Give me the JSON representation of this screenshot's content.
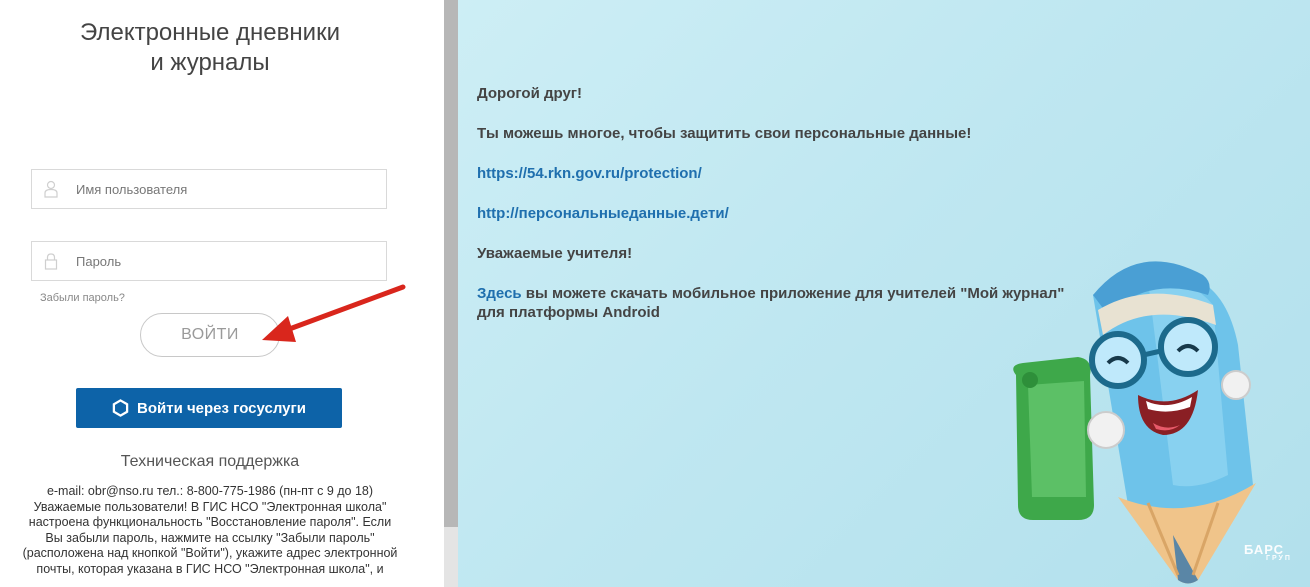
{
  "login": {
    "title": "Электронные дневники\nи журналы",
    "username_placeholder": "Имя пользователя",
    "password_placeholder": "Пароль",
    "forgot_link": "Забыли пароль?",
    "login_button": "ВОЙТИ",
    "gosuslugi_button": "Войти через госуслуги",
    "support_title": "Техническая поддержка",
    "support_text": "e-mail: obr@nso.ru тел.: 8-800-775-1986 (пн-пт с 9 до 18) Уважаемые пользователи! В ГИС НСО \"Электронная школа\" настроена функциональность \"Восстановление пароля\". Если Вы забыли пароль, нажмите на ссылку \"Забыли пароль\" (расположена над кнопкой \"Войти\"), укажите адрес электронной почты, которая указана в ГИС НСО \"Электронная школа\", и"
  },
  "info": {
    "greeting": "Дорогой друг!",
    "protect_text": "Ты можешь многое, чтобы защитить свои персональные данные!",
    "link1": "https://54.rkn.gov.ru/protection/",
    "link2": "http://персональныеданные.дети/",
    "teachers": "Уважаемые учителя!",
    "here_link": "Здесь",
    "download_text": " вы можете скачать мобильное приложение для учителей \"Мой журнал\" для платформы Android"
  },
  "logo": {
    "name": "БАРС",
    "sub": "ГРУП"
  },
  "colors": {
    "accent_blue": "#0d63a8",
    "link_blue": "#1f6fae",
    "arrow_red": "#d9261c",
    "panel_bg": "#bfe7f1"
  },
  "icons": {
    "user": "user-icon",
    "lock": "lock-icon",
    "gosuslugi": "gosuslugi-hex-icon",
    "arrow": "red-arrow-annotation"
  }
}
